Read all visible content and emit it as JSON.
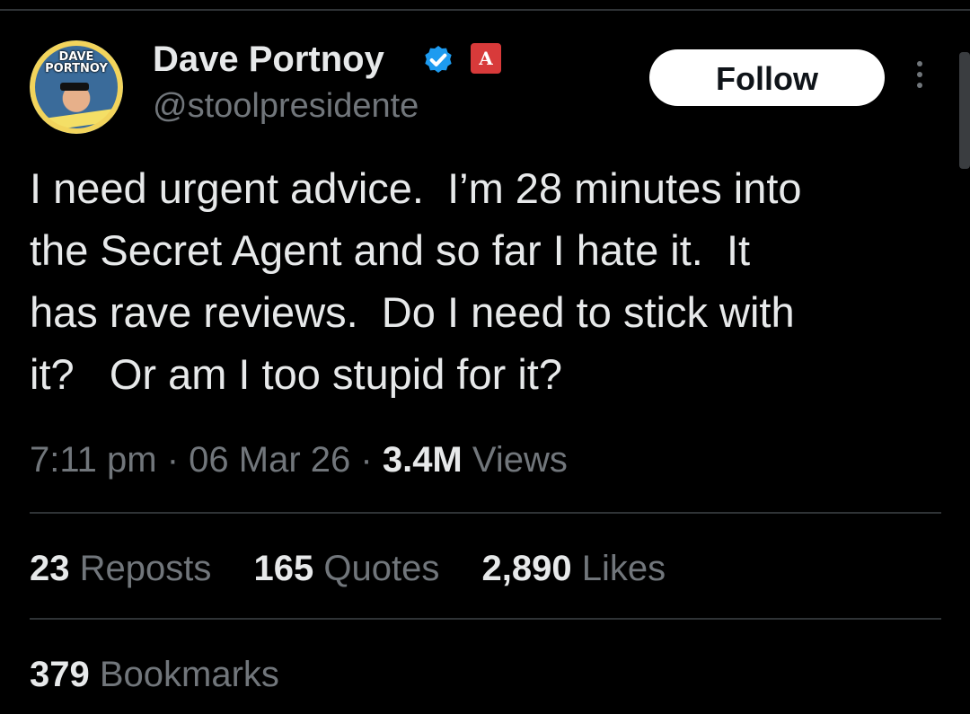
{
  "user": {
    "display_name": "Dave Portnoy",
    "handle": "@stoolpresidente",
    "avatar_text": "DAVE\nPORTNOY",
    "verified_icon": "verified-check-icon",
    "affiliate_icon": "barstool-logo-icon"
  },
  "actions": {
    "follow_label": "Follow",
    "more_icon": "more-vertical-icon"
  },
  "tweet": {
    "text": "I need urgent advice.  I’m 28 minutes into\nthe Secret Agent and so far I hate it.  It\nhas rave reviews.  Do I need to stick with\nit?   Or am I too stupid for it?",
    "time": "7:11 pm",
    "separator": "·",
    "date": "06 Mar 26",
    "views_count": "3.4M",
    "views_label": "Views"
  },
  "stats": {
    "reposts_count": "23",
    "reposts_label": "Reposts",
    "quotes_count": "165",
    "quotes_label": "Quotes",
    "likes_count": "2,890",
    "likes_label": "Likes",
    "bookmarks_count": "379",
    "bookmarks_label": "Bookmarks"
  },
  "colors": {
    "background": "#000000",
    "text_primary": "#e7e9ea",
    "text_secondary": "#71767b",
    "verified_blue": "#1d9bf0",
    "divider": "#2f3336"
  }
}
